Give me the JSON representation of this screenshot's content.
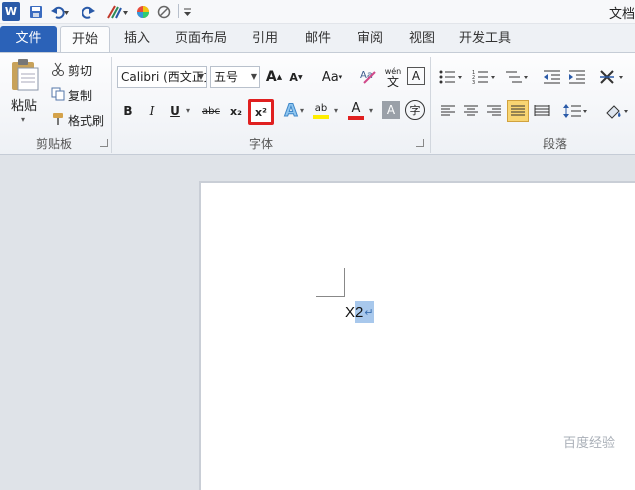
{
  "window": {
    "title": "文档"
  },
  "qat": {
    "logo": "W"
  },
  "tabs": [
    {
      "label": "文件"
    },
    {
      "label": "开始"
    },
    {
      "label": "插入"
    },
    {
      "label": "页面布局"
    },
    {
      "label": "引用"
    },
    {
      "label": "邮件"
    },
    {
      "label": "审阅"
    },
    {
      "label": "视图"
    },
    {
      "label": "开发工具"
    }
  ],
  "clipboard": {
    "paste": "粘贴",
    "cut": "剪切",
    "copy": "复制",
    "format_painter": "格式刷",
    "group": "剪贴板"
  },
  "font": {
    "name": "Calibri (西文正文)",
    "size": "五号",
    "grow": "A",
    "shrink": "A",
    "change_case": "Aa",
    "pinyin_top": "wén",
    "pinyin_char": "文",
    "border": "A",
    "bold": "B",
    "italic": "I",
    "underline": "U",
    "strike": "abc",
    "subscript": "x₂",
    "superscript": "x²",
    "effects": "A",
    "highlight": "ab",
    "color": "A",
    "shading": "A",
    "enclose": "字",
    "group": "字体"
  },
  "paragraph": {
    "group": "段落"
  },
  "document": {
    "text_plain": "X",
    "text_selected": "2",
    "para_mark": "↵"
  },
  "colors": {
    "accent": "#2b62b8",
    "selection": "#a8c8ec",
    "highlight_red": "#e02020",
    "active_btn": "#f8d572"
  },
  "watermark": "百度经验"
}
